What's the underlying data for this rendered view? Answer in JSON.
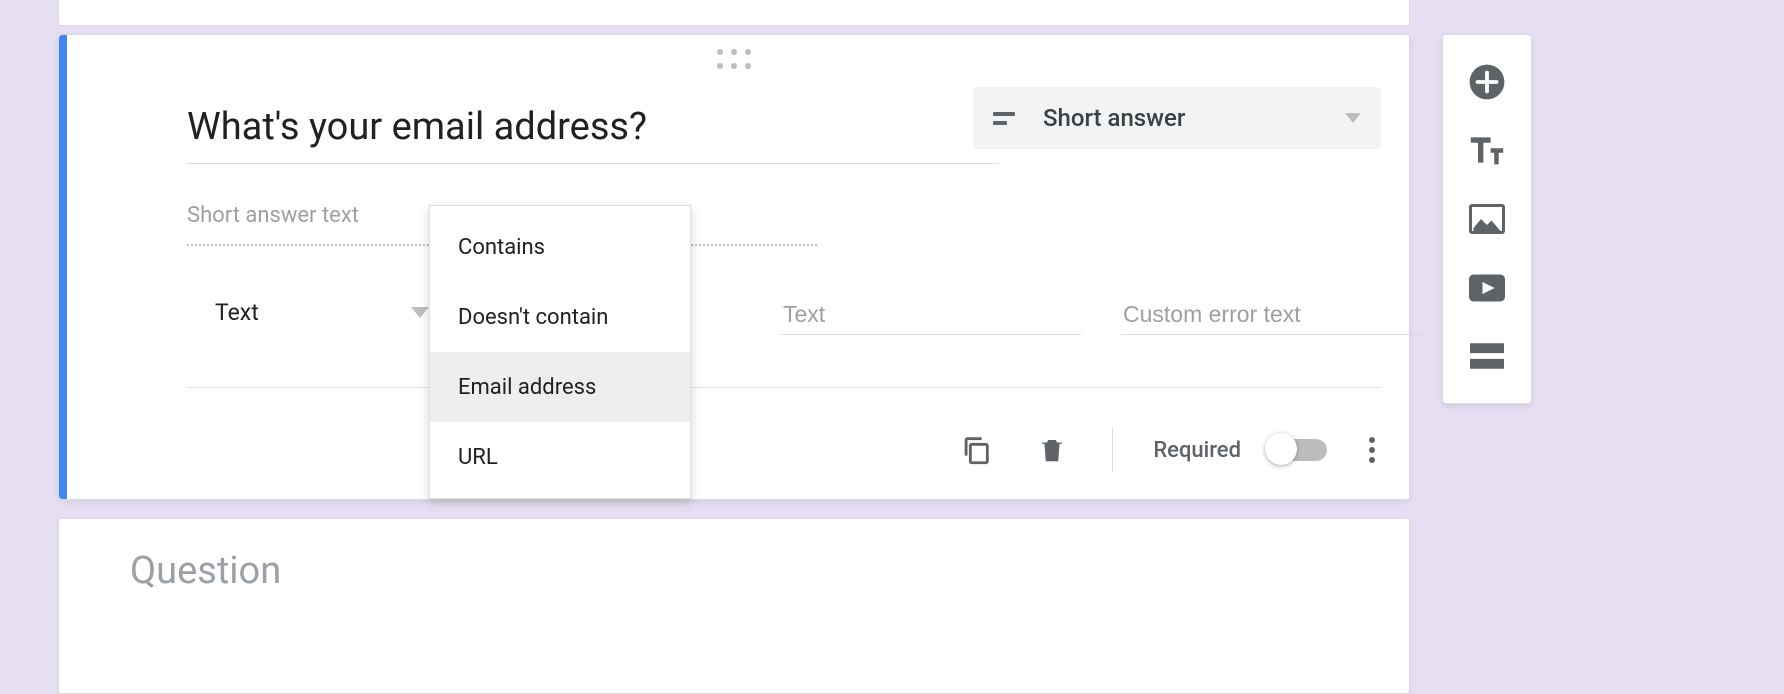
{
  "question": {
    "title": "What's your email address?",
    "answer_placeholder": "Short answer text",
    "type_label": "Short answer"
  },
  "validation": {
    "type_label": "Text",
    "input_placeholder": "Text",
    "error_placeholder": "Custom error text",
    "menu": {
      "opt1": "Contains",
      "opt2": "Doesn't contain",
      "opt3": "Email address",
      "opt4": "URL"
    }
  },
  "footer": {
    "required_label": "Required"
  },
  "next_card": {
    "placeholder": "Question"
  }
}
